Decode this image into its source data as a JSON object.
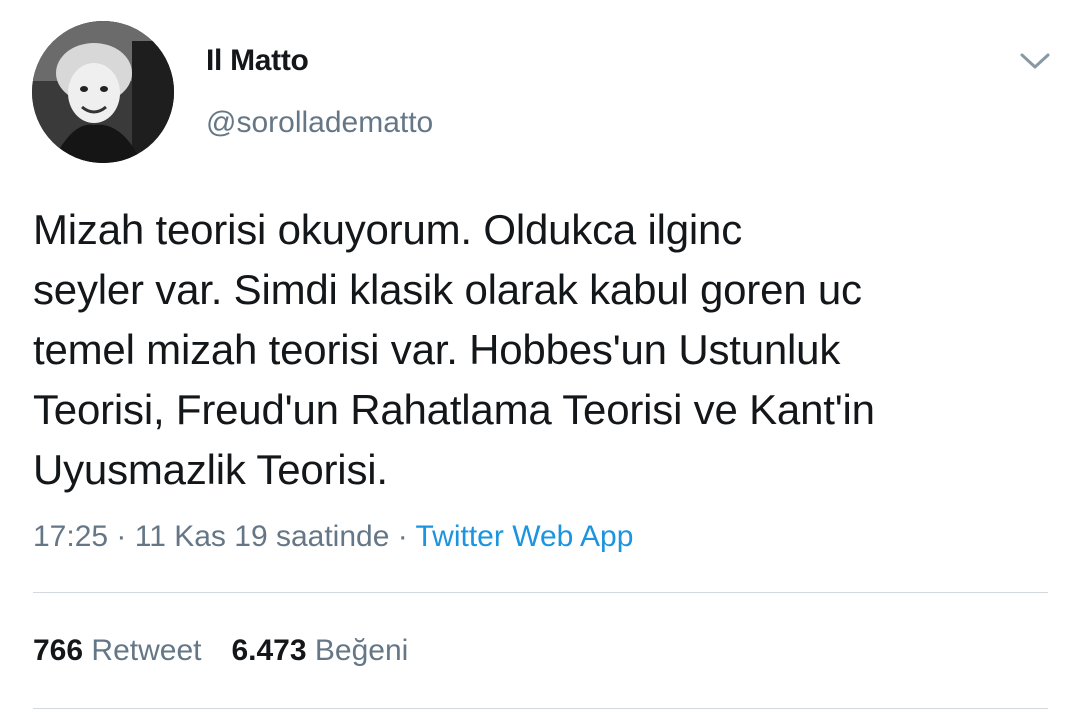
{
  "author": {
    "display_name": "Il Matto",
    "handle": "@sorolladematto",
    "avatar_icon": "profile-photo"
  },
  "header": {
    "menu_icon": "chevron-down-icon"
  },
  "tweet": {
    "lines": [
      "Mizah teorisi okuyorum. Oldukca ilginc",
      "seyler var. Simdi klasik olarak kabul goren uc",
      "temel mizah teorisi var. Hobbes'un Ustunluk",
      "Teorisi, Freud'un Rahatlama Teorisi ve Kant'in",
      "Uyusmazlik Teorisi."
    ]
  },
  "meta": {
    "time": "17:25",
    "separator1": " · ",
    "date": "11 Kas 19 saatinde",
    "separator2": " · ",
    "source": "Twitter Web App"
  },
  "stats": {
    "retweet_count": "766",
    "retweet_label": "Retweet",
    "like_count": "6.473",
    "like_label": "Beğeni"
  },
  "colors": {
    "text": "#14171a",
    "secondary": "#657786",
    "link": "#1b95e0",
    "divider": "#d3d9dd"
  }
}
